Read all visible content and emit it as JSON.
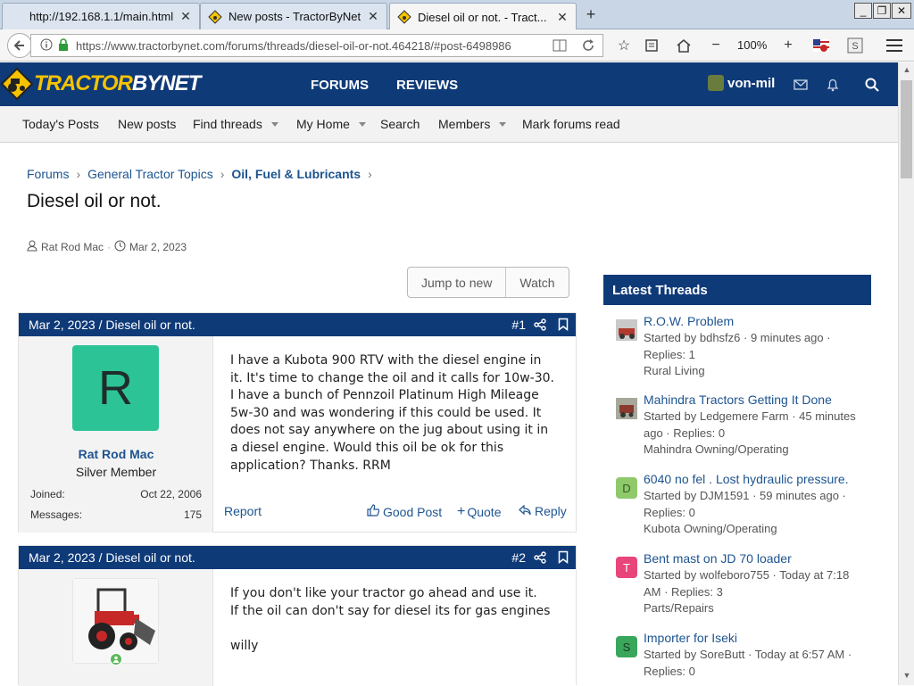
{
  "browser": {
    "tabs": [
      {
        "title": "http://192.168.1.1/main.html"
      },
      {
        "title": "New posts - TractorByNet"
      },
      {
        "title": "Diesel oil or not. - Tract..."
      }
    ],
    "url": "https://www.tractorbynet.com/forums/threads/diesel-oil-or-not.464218/#post-6498986",
    "zoom": "100%",
    "window_buttons": [
      "_",
      "❐",
      "✕"
    ]
  },
  "site": {
    "logo_word1": "TRACTOR",
    "logo_word2": "BYNET",
    "brand_color": "#0f3a78",
    "nav": [
      "FORUMS",
      "REVIEWS"
    ],
    "username": "von-mil"
  },
  "subnav": [
    {
      "label": "Today's Posts",
      "dropdown": false
    },
    {
      "label": "New posts",
      "dropdown": false
    },
    {
      "label": "Find threads",
      "dropdown": true
    },
    {
      "label": "My Home",
      "dropdown": true
    },
    {
      "label": "Search",
      "dropdown": false
    },
    {
      "label": "Members",
      "dropdown": true
    },
    {
      "label": "Mark forums read",
      "dropdown": false
    }
  ],
  "breadcrumb": [
    "Forums",
    "General Tractor Topics",
    "Oil, Fuel & Lubricants"
  ],
  "thread": {
    "title": "Diesel oil or not.",
    "starter": "Rat Rod Mac",
    "date": "Mar 2, 2023",
    "jump_label": "Jump to new",
    "watch_label": "Watch"
  },
  "posts": [
    {
      "header": "Mar 2, 2023 / Diesel oil or not.",
      "number": "#1",
      "avatar_letter": "R",
      "author": "Rat Rod Mac",
      "rank": "Silver Member",
      "joined_label": "Joined:",
      "joined": "Oct 22, 2006",
      "messages_label": "Messages:",
      "messages": "175",
      "lines": [
        "I have a Kubota 900 RTV with the diesel engine in",
        "it. It's time to change the oil and it calls for 10w-30.",
        "I have a bunch of Pennzoil Platinum High Mileage",
        "5w-30 and was wondering if this could be used. It",
        "does not say anywhere on the jug about using it in",
        "a diesel engine. Would this oil be ok for this",
        "application? Thanks. RRM"
      ],
      "report": "Report",
      "good_post": "Good Post",
      "quote": "Quote",
      "reply": "Reply"
    },
    {
      "header": "Mar 2, 2023 / Diesel oil or not.",
      "number": "#2",
      "lines": [
        "If you don't like your tractor go ahead and use it.",
        "If the oil can don't say for diesel its for gas engines",
        "",
        "willy"
      ]
    }
  ],
  "sidebar": {
    "heading": "Latest Threads",
    "threads": [
      {
        "title": "R.O.W. Problem",
        "meta": [
          "Started by bdhsfz6 · 9 minutes ago ·",
          "Replies: 1",
          "Rural Living"
        ],
        "avatar": "",
        "avatar_color": "#8a5a4a"
      },
      {
        "title": "Mahindra Tractors Getting It Done",
        "meta": [
          "Started by Ledgemere Farm · 45 minutes",
          "ago · Replies: 0",
          "Mahindra Owning/Operating"
        ],
        "avatar": "",
        "avatar_color": "#7a6a5a"
      },
      {
        "title": "6040 no fel . Lost hydraulic pressure.",
        "meta": [
          "Started by DJM1591 · 59 minutes ago ·",
          "Replies: 0",
          "Kubota Owning/Operating"
        ],
        "avatar": "D",
        "avatar_color": "#8fc96a"
      },
      {
        "title": "Bent mast on JD 70 loader",
        "meta": [
          "Started by wolfeboro755 · Today at 7:18",
          "AM · Replies: 3",
          "Parts/Repairs"
        ],
        "avatar": "T",
        "avatar_color": "#e8457a"
      },
      {
        "title": "Importer for Iseki",
        "meta": [
          "Started by SoreButt · Today at 6:57 AM ·",
          "Replies: 0"
        ],
        "avatar": "S",
        "avatar_color": "#3aa65c"
      }
    ]
  }
}
